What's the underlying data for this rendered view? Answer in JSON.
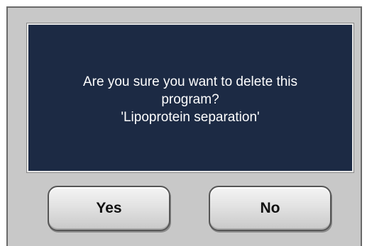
{
  "dialog": {
    "message_lines": [
      "Are you sure you want to delete this",
      "program?",
      "'Lipoprotein separation'"
    ],
    "yes_label": "Yes",
    "no_label": "No"
  },
  "colors": {
    "panel_background": "#1c2a44",
    "frame_background": "#c8c8c8",
    "message_text": "#ffffff"
  }
}
